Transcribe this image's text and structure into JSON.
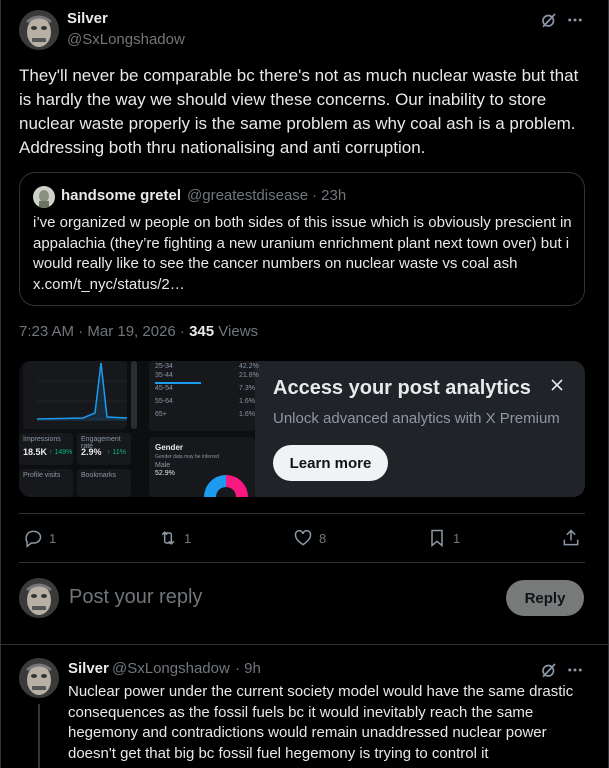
{
  "post": {
    "author_name": "Silver",
    "author_handle": "@SxLongshadow",
    "text": "They'll never be comparable bc there's not as much nuclear waste but that is hardly the way we should view these concerns. Our inability to store nuclear waste properly is the same problem as why coal ash is a problem. Addressing both thru nationalising and anti corruption.",
    "timestamp": "7:23 AM · Mar 19, 2026 · ",
    "views_count": "345",
    "views_label": " Views",
    "icons": {
      "grok": "grok-icon",
      "more": "more-icon"
    }
  },
  "quote": {
    "author_name": "handsome gretel",
    "author_handle": "@greatestdisease",
    "time": "· 23h",
    "text": "i’ve organized w people on both sides of this issue which is obviously prescient in appalachia (they’re fighting a new uranium enrichment plant next town over) but i would really like to see the cancer numbers on nuclear waste vs coal ash x.com/t_nyc/status/2…"
  },
  "promo": {
    "title": "Access your post analytics",
    "subtitle": "Unlock advanced analytics with X Premium",
    "button": "Learn more",
    "preview": {
      "impressions_label": "Impressions",
      "impressions_value": "18.5K",
      "impressions_change": "↑ 149%",
      "engagement_label": "Engagement rate",
      "engagement_value": "2.9%",
      "engagement_change": "↑ 11%",
      "profile_visits_label": "Profile visits",
      "bookmarks_label": "Bookmarks",
      "age_groups": [
        {
          "label": "25-34",
          "value": "42.2%"
        },
        {
          "label": "35-44",
          "value": "21.8%"
        },
        {
          "label": "45-54",
          "value": "7.3%"
        },
        {
          "label": "55-64",
          "value": "1.6%"
        },
        {
          "label": "65+",
          "value": "1.6%"
        }
      ],
      "gender_title": "Gender",
      "gender_subtitle": "Gender data may be inferred",
      "gender_male_label": "Male",
      "gender_male_value": "52.9%"
    }
  },
  "actions": {
    "replies": "1",
    "reposts": "1",
    "likes": "8",
    "bookmarks": "1"
  },
  "compose": {
    "placeholder": "Post your reply",
    "button": "Reply"
  },
  "reply": {
    "author_name": "Silver",
    "author_handle": "@SxLongshadow",
    "time": "· 9h",
    "text": "Nuclear power under the current society model would have the same drastic consequences as the fossil fuels bc it would inevitably reach the same hegemony and contradictions would remain unaddressed nuclear power doesn't get that big bc fossil fuel hegemony is trying to control it"
  },
  "colors": {
    "background": "#000000",
    "accent": "#1d9bf0",
    "border": "#2f3336",
    "muted": "#71767b"
  }
}
